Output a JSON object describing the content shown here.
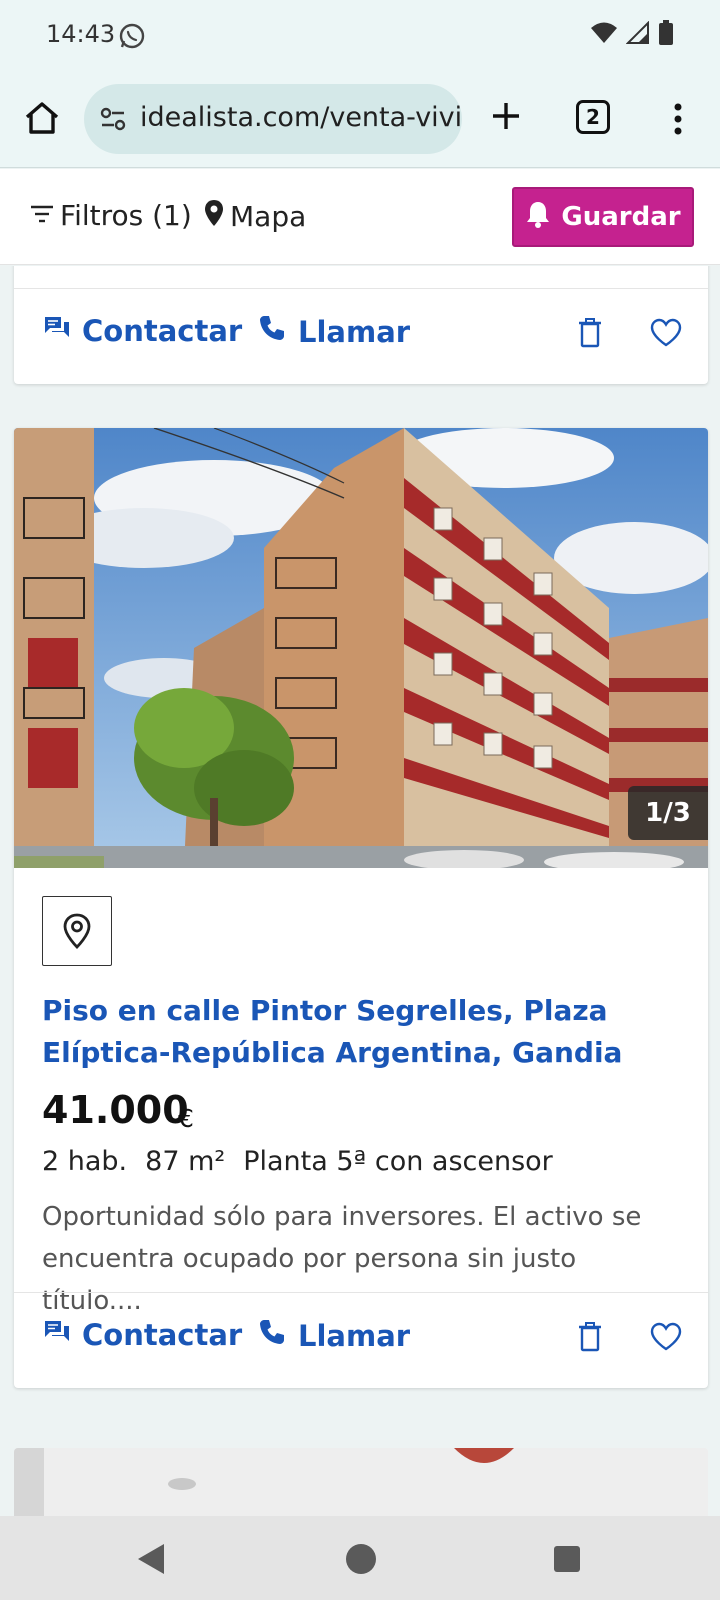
{
  "status_bar": {
    "time": "14:43",
    "icons": [
      "whatsapp-icon",
      "wifi-icon",
      "signal-icon",
      "battery-icon"
    ]
  },
  "browser": {
    "url": "idealista.com/venta-vivie",
    "tab_count": "2",
    "icons": [
      "home-icon",
      "site-info-icon",
      "new-tab-icon",
      "more-icon"
    ]
  },
  "toolbar": {
    "filters_label": "Filtros (1)",
    "map_label": "Mapa",
    "save_label": "Guardar",
    "save_color": "#c5228f"
  },
  "actions": {
    "contact_label": "Contactar",
    "call_label": "Llamar",
    "link_color": "#1a56b6"
  },
  "listing": {
    "photo_counter": "1/3",
    "title": "Piso en calle Pintor Segrelles, Plaza Elíptica-República Argentina, Gandia",
    "price": "41.000",
    "currency": "€",
    "features": [
      "2 hab.",
      "87 m²",
      "Planta 5ª con ascensor"
    ],
    "description": "Oportunidad sólo para inversores. El activo se encuentra ocupado por persona sin justo título...."
  }
}
